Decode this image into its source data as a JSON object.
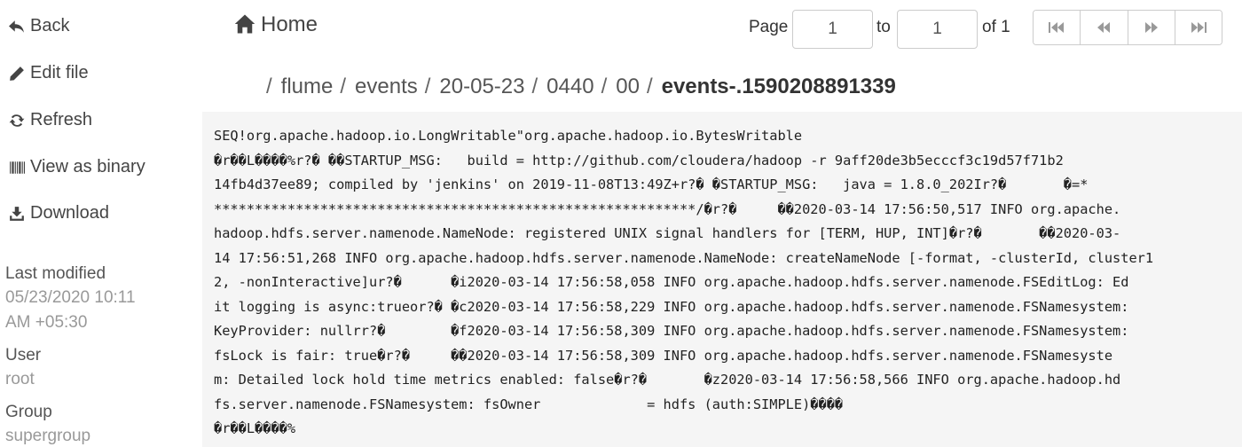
{
  "sidebar": {
    "actions": [
      {
        "label": "Back",
        "icon": "reply-icon"
      },
      {
        "label": "Edit file",
        "icon": "pencil-icon"
      },
      {
        "label": "Refresh",
        "icon": "refresh-icon"
      },
      {
        "label": "View as binary",
        "icon": "barcode-icon"
      },
      {
        "label": "Download",
        "icon": "download-icon"
      }
    ],
    "last_modified_label": "Last modified",
    "last_modified_line1": "05/23/2020 10:11",
    "last_modified_line2": "AM +05:30",
    "user_label": "User",
    "user_value": "root",
    "group_label": "Group",
    "group_value": "supergroup"
  },
  "header": {
    "home_label": "Home",
    "page_label": "Page",
    "page_value": "1",
    "to_label": "to",
    "to_value": "1",
    "of_label": "of 1"
  },
  "breadcrumb": {
    "items": [
      "flume",
      "events",
      "20-05-23",
      "0440",
      "00"
    ],
    "current": "events-.1590208891339"
  },
  "content": {
    "lines": [
      "SEQ\u0006!org.apache.hadoop.io.LongWritable\"org.apache.hadoop.io.BytesWritable",
      "�r��\u0010L����\u0010\u0010%\u0010\u0010\u0010r?� ��STARTUP_MSG:   build = http://github.com/cloudera/hadoop -r 9aff20de3b5ecccf3c19d57f71b2",
      "14fb4d37ee89; compiled by 'jenkins' on 2019-11-08T13:49Z+\u0010\u0010r?� �\u0010STARTUP_MSG:   java = 1.8.0_202I\u0010\u0010r?�       �=*",
      "***********************************************************/�\u0010\u0010r?�     ��2020-03-14 17:56:50,517 INFO org.apache.",
      "hadoop.hdfs.server.namenode.NameNode: registered UNIX signal handlers for [TERM, HUP, INT]�\u0010\u0010r?�       ��2020-03-",
      "14 17:56:51,268 INFO org.apache.hadoop.hdfs.server.namenode.NameNode: createNameNode [-format, -clusterId, cluster1",
      "2, -nonInteractive]u\u0010\u0010r?�      �i2020-03-14 17:56:58,058 INFO org.apache.hadoop.hdfs.server.namenode.FSEditLog: Ed",
      "it logging is async:trueo\u0010\u0010r?� �c2020-03-14 17:56:58,229 INFO org.apache.hadoop.hdfs.server.namenode.FSNamesystem:",
      "KeyProvider: nullr\u0010\u0010r?�        �f2020-03-14 17:56:58,309 INFO org.apache.hadoop.hdfs.server.namenode.FSNamesystem:",
      "fsLock is fair: true�\u0010\u0010r?�     ��2020-03-14 17:56:58,309 INFO org.apache.hadoop.hdfs.server.namenode.FSNamesyste",
      "m: Detailed lock hold time metrics enabled: false�\u0010\u0010r?�       �z2020-03-14 17:56:58,566 INFO org.apache.hadoop.hd",
      "fs.server.namenode.FSNamesystem: fsOwner             = hdfs (auth:SIMPLE)����",
      "�r��\u0010L����\u0010\u0010%"
    ]
  }
}
